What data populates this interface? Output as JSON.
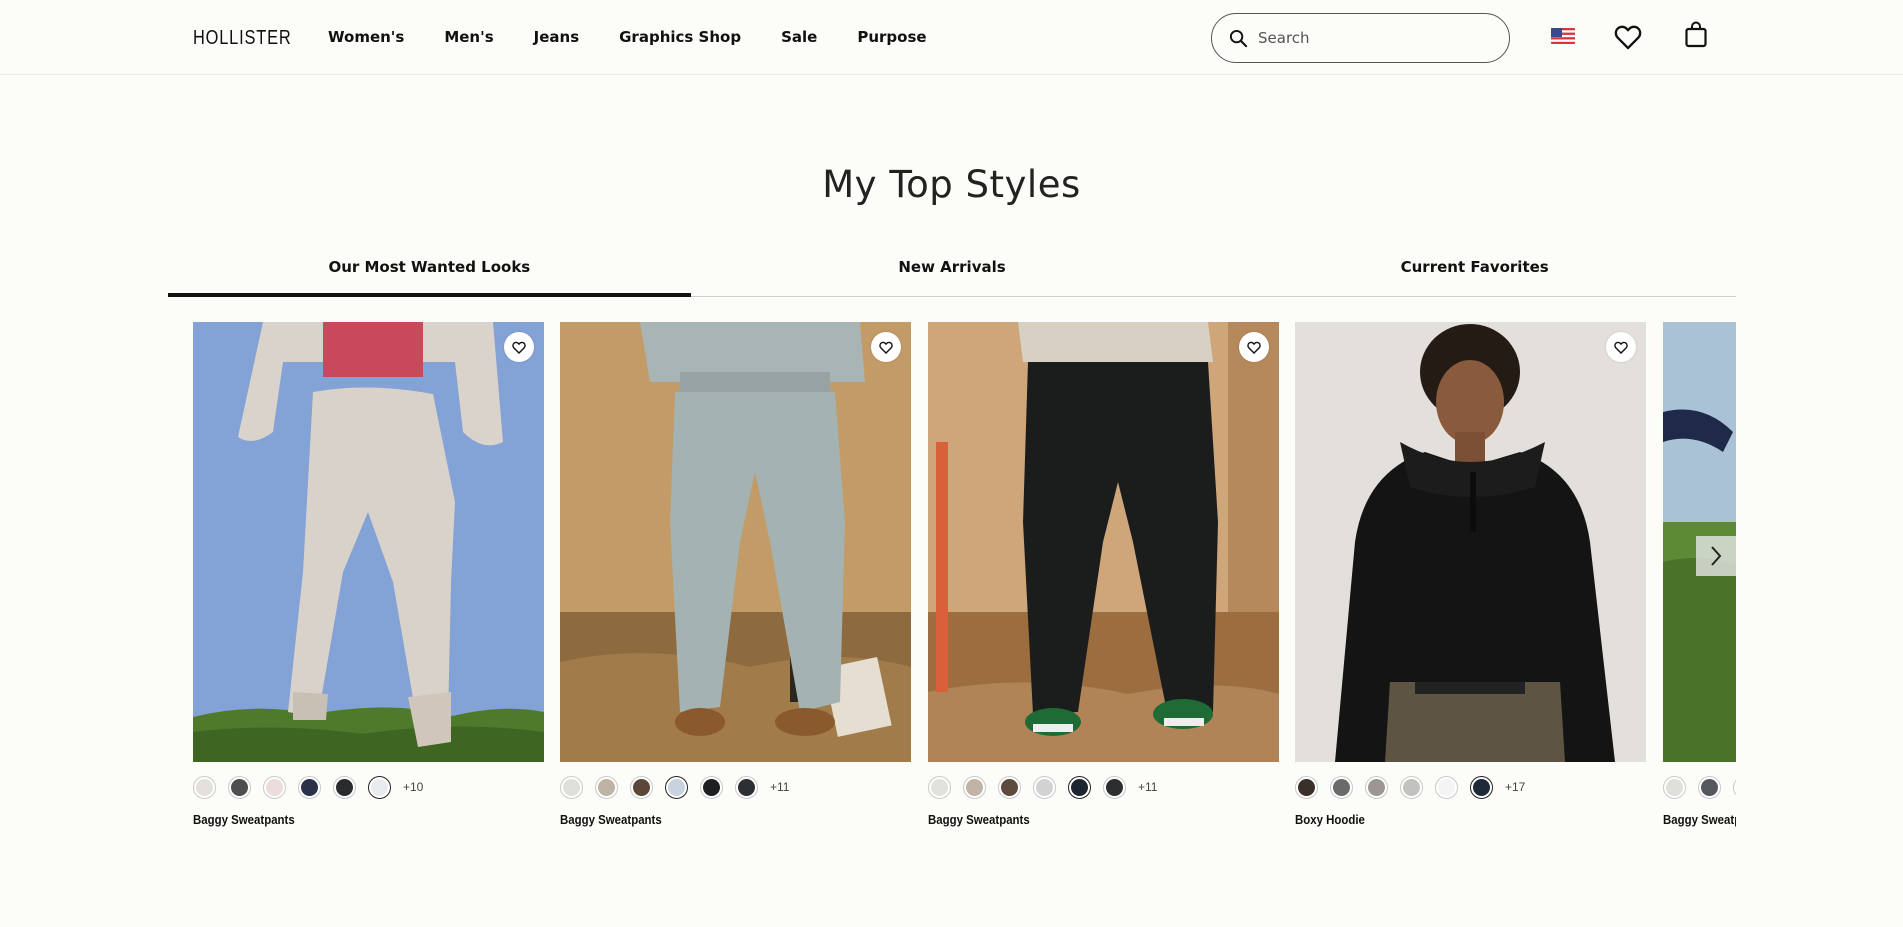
{
  "header": {
    "logo": "HOLLISTER",
    "nav": [
      "Women's",
      "Men's",
      "Jeans",
      "Graphics Shop",
      "Sale",
      "Purpose"
    ],
    "search_placeholder": "Search"
  },
  "section": {
    "title": "My Top Styles",
    "tabs": [
      {
        "label": "Our Most Wanted Looks",
        "active": true
      },
      {
        "label": "New Arrivals",
        "active": false
      },
      {
        "label": "Current Favorites",
        "active": false
      }
    ]
  },
  "products": [
    {
      "name": "Baggy Sweatpants",
      "swatches": [
        "#e4e1dc",
        "#4e4e50",
        "#ecdcdc",
        "#2b3148",
        "#2a2b2d",
        "#e8ecf1"
      ],
      "selected_swatch": 5,
      "more": "+10"
    },
    {
      "name": "Baggy Sweatpants",
      "swatches": [
        "#dededa",
        "#bfb3a5",
        "#5c4638",
        "#c9d3df",
        "#1e1f20",
        "#2c2f33"
      ],
      "selected_swatch": 3,
      "more": "+11"
    },
    {
      "name": "Baggy Sweatpants",
      "swatches": [
        "#e2e1dd",
        "#c1b4a6",
        "#5c4a3e",
        "#d2d2d2",
        "#1d2630",
        "#2c2e30"
      ],
      "selected_swatch": 4,
      "more": "+11"
    },
    {
      "name": "Boxy Hoodie",
      "swatches": [
        "#3a302a",
        "#6a6a6a",
        "#9d9694",
        "#c2c2c0",
        "#f4f4f4",
        "#1d2a38"
      ],
      "selected_swatch": 5,
      "more": "+17"
    },
    {
      "name": "Baggy Sweatpants",
      "swatches": [
        "#dfe0da",
        "#54575e",
        "#e7e7e2"
      ],
      "selected_swatch": -1,
      "more": ""
    }
  ]
}
